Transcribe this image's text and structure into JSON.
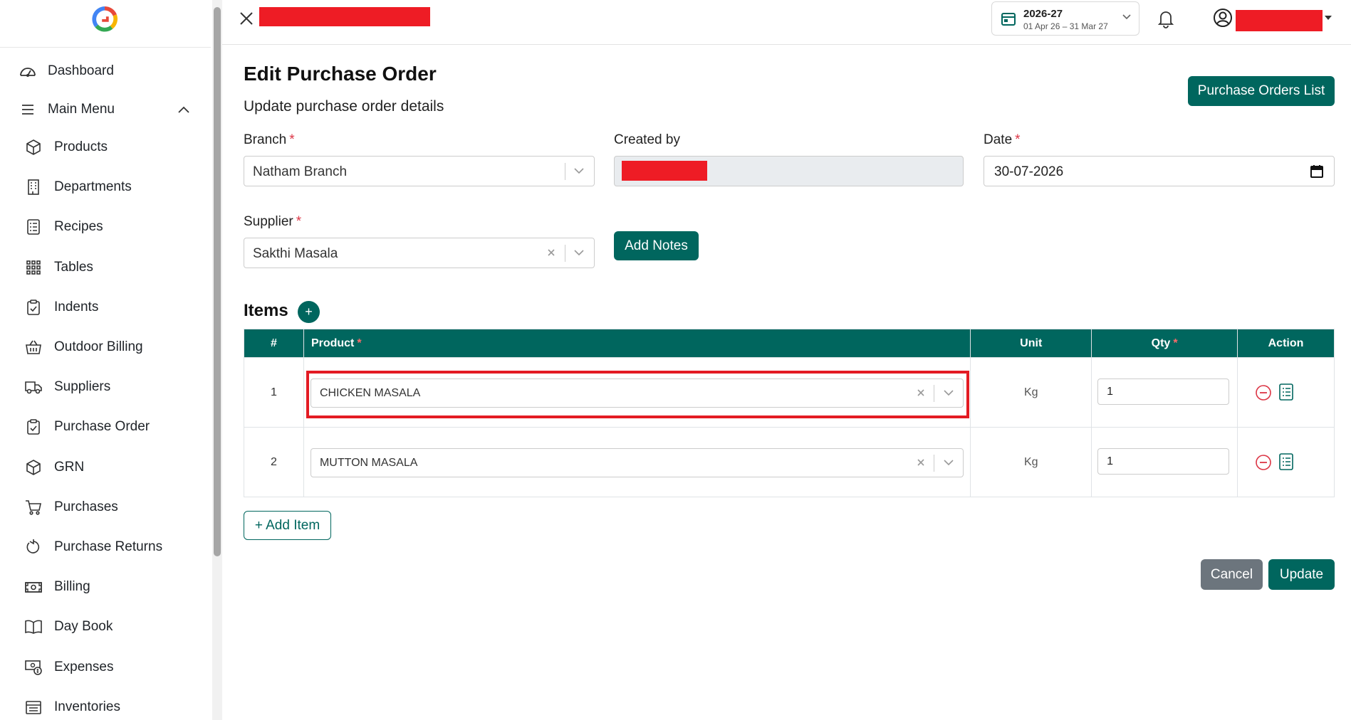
{
  "sidebar": {
    "dashboard": "Dashboard",
    "main_menu": "Main Menu",
    "items": [
      {
        "label": "Products",
        "icon": "box-icon"
      },
      {
        "label": "Departments",
        "icon": "building-icon"
      },
      {
        "label": "Recipes",
        "icon": "recipe-list-icon"
      },
      {
        "label": "Tables",
        "icon": "grid-icon"
      },
      {
        "label": "Indents",
        "icon": "clipboard-icon"
      },
      {
        "label": "Outdoor Billing",
        "icon": "basket-icon"
      },
      {
        "label": "Suppliers",
        "icon": "truck-icon"
      },
      {
        "label": "Purchase Order",
        "icon": "clipboard-check-icon"
      },
      {
        "label": "GRN",
        "icon": "box-icon"
      },
      {
        "label": "Purchases",
        "icon": "cart-icon"
      },
      {
        "label": "Purchase Returns",
        "icon": "return-icon"
      },
      {
        "label": "Billing",
        "icon": "cash-icon"
      },
      {
        "label": "Day Book",
        "icon": "book-icon"
      },
      {
        "label": "Expenses",
        "icon": "expense-icon"
      },
      {
        "label": "Inventories",
        "icon": "inventory-icon"
      }
    ]
  },
  "topbar": {
    "fiscal_year": "2026-27",
    "fiscal_range": "01 Apr 26 – 31 Mar 27"
  },
  "page": {
    "title": "Edit Purchase Order",
    "subtitle": "Update purchase order details",
    "list_button": "Purchase Orders List"
  },
  "form": {
    "branch_label": "Branch",
    "branch_value": "Natham Branch",
    "created_by_label": "Created by",
    "date_label": "Date",
    "date_value": "30-07-2026",
    "supplier_label": "Supplier",
    "supplier_value": "Sakthi Masala",
    "add_notes": "Add Notes",
    "required_mark": "*"
  },
  "items": {
    "title": "Items",
    "plus": "+",
    "columns": {
      "num": "#",
      "product": "Product",
      "unit": "Unit",
      "qty": "Qty",
      "action": "Action"
    },
    "rows": [
      {
        "num": "1",
        "product": "CHICKEN MASALA",
        "unit": "Kg",
        "qty": "1"
      },
      {
        "num": "2",
        "product": "MUTTON MASALA",
        "unit": "Kg",
        "qty": "1"
      }
    ],
    "add_item": "+ Add Item"
  },
  "footer": {
    "cancel": "Cancel",
    "update": "Update"
  },
  "colors": {
    "primary": "#00665e",
    "danger": "#dc3545",
    "redaction": "#ee1c25",
    "highlight": "#e31b23"
  }
}
